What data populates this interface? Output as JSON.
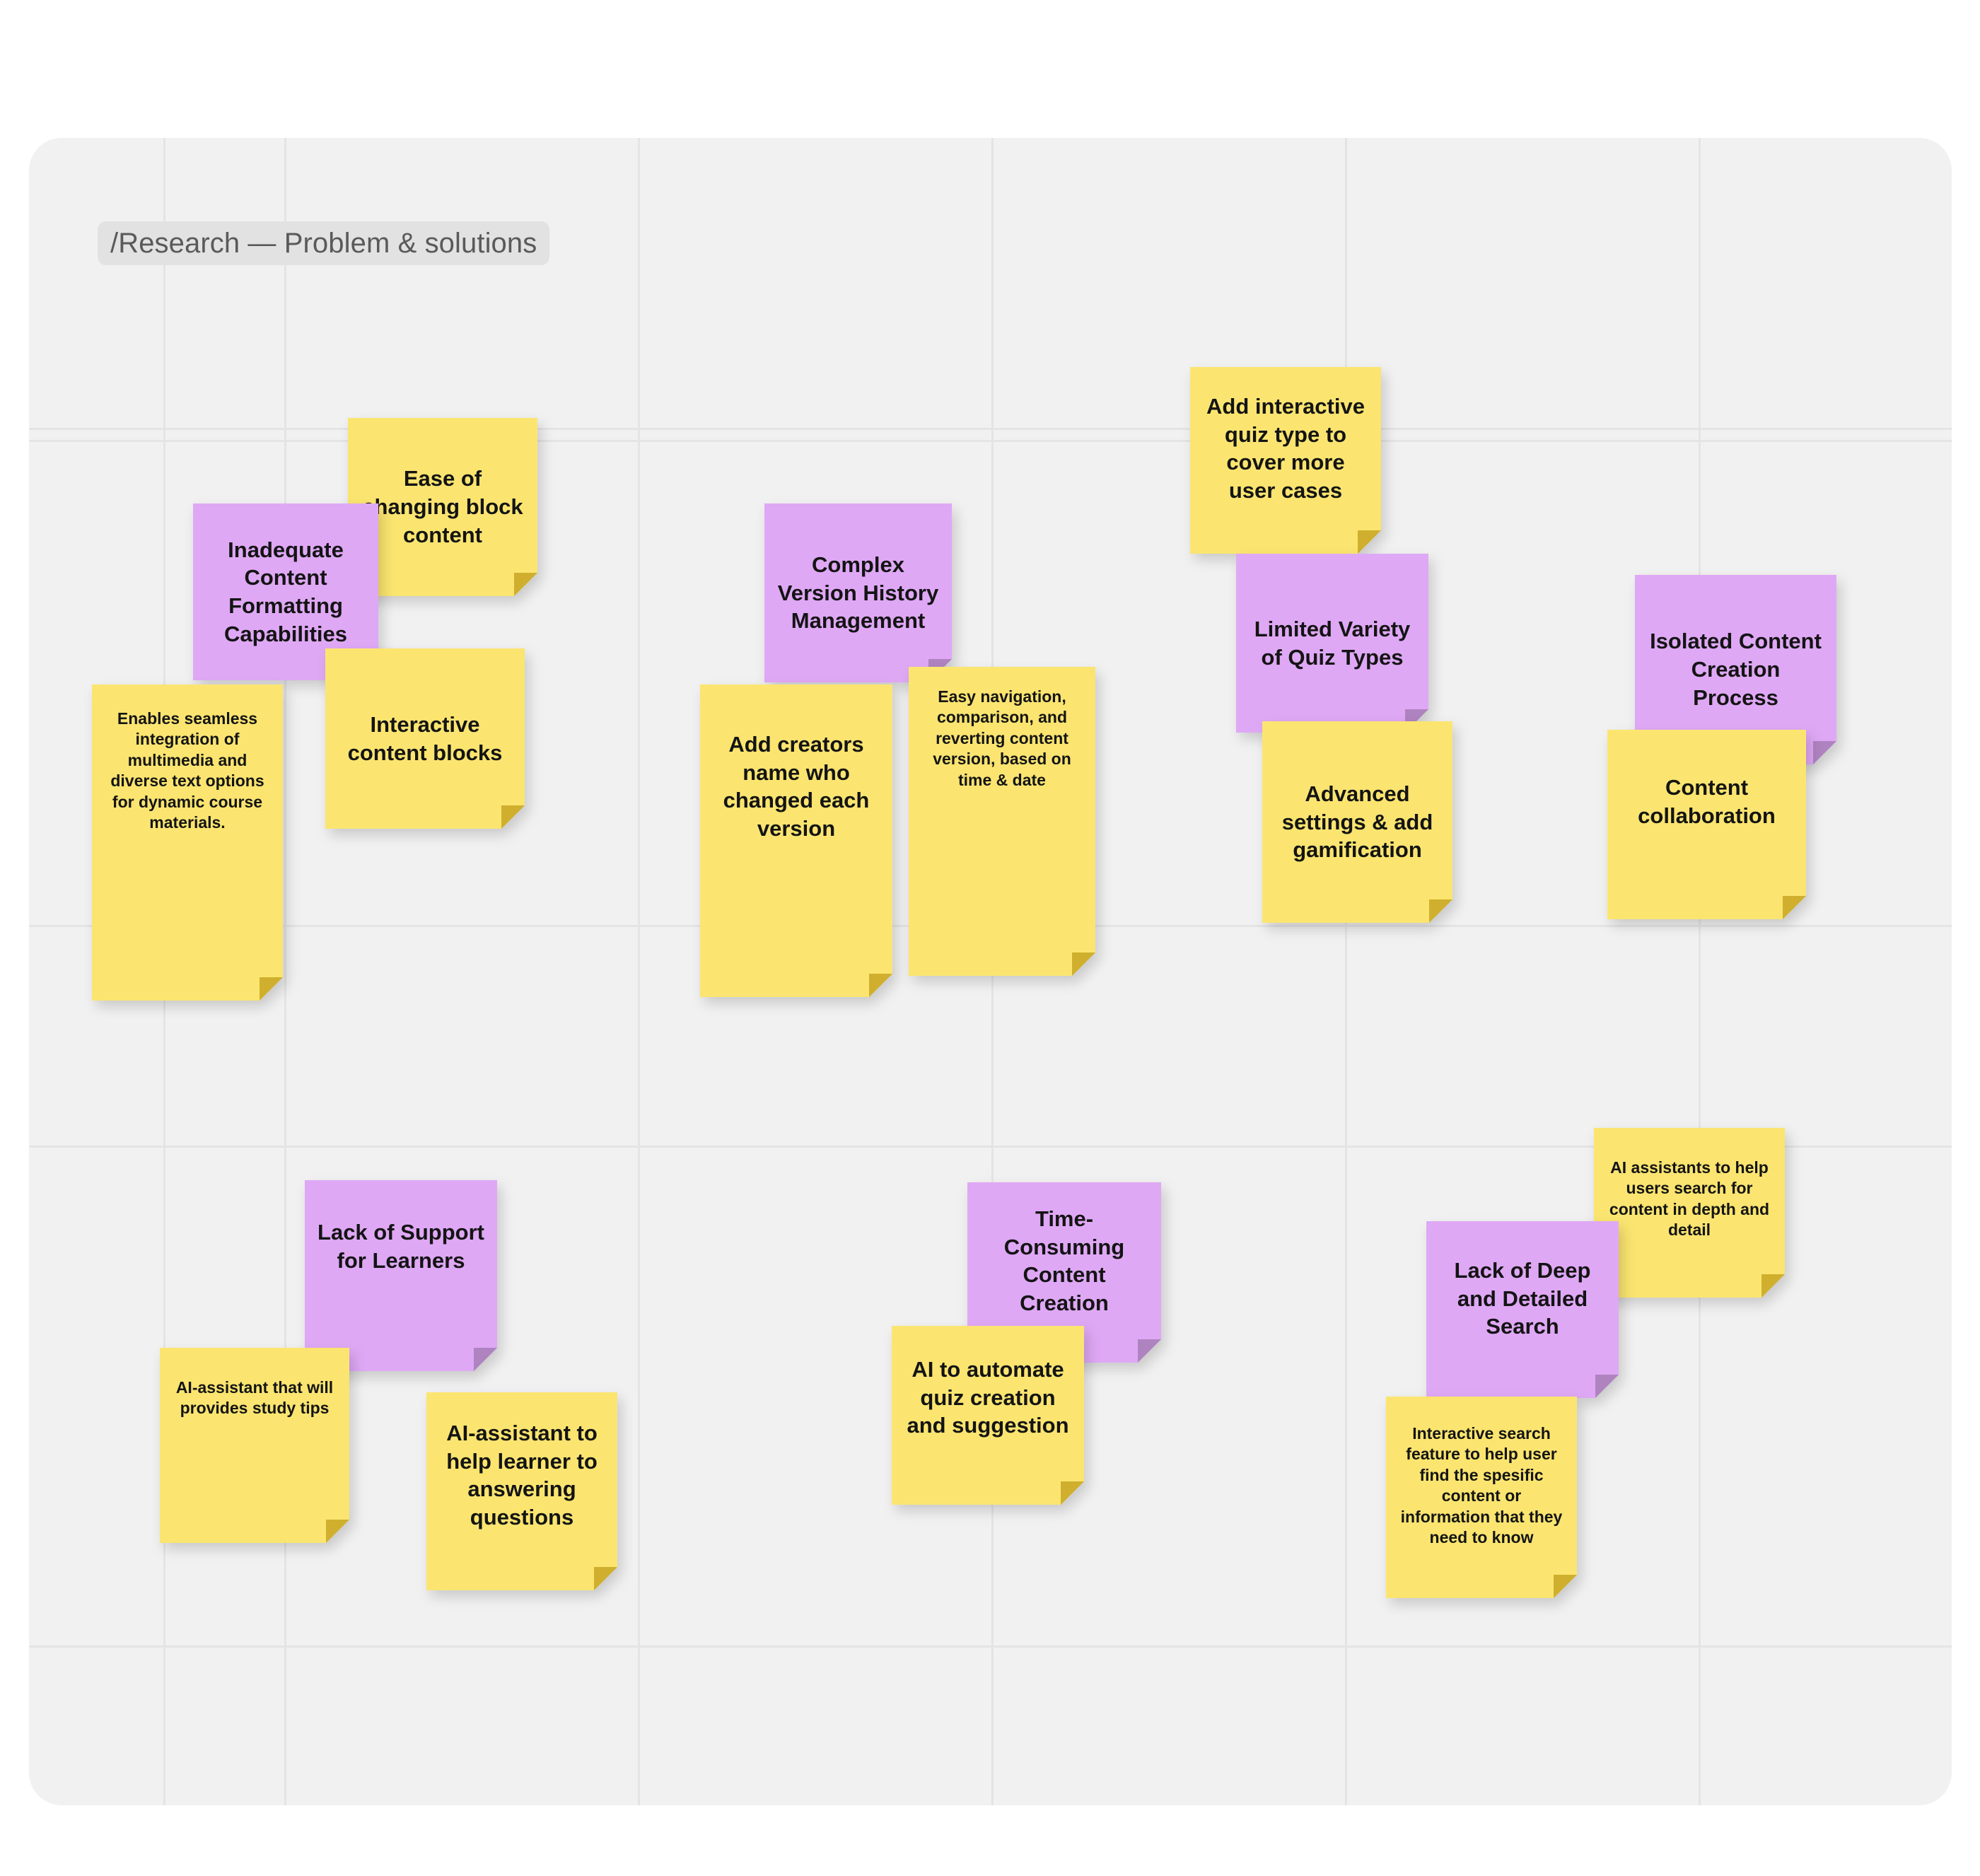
{
  "board": {
    "frame_label": "/Research — Problem & solutions",
    "background_color": "#f1f1f1",
    "page_background": "#ffffff",
    "grid_line_color": "#e4e4e4",
    "chip_background": "#e2e2e2",
    "chip_text_color": "#5a5a5a"
  },
  "palette": {
    "problem_note": "#dfa8f5",
    "problem_fold": "#af83c0",
    "solution_note": "#fbe570",
    "solution_fold": "#cfaf2d",
    "note_text": "#141414"
  },
  "clusters": [
    {
      "id": "content-formatting",
      "problem": "Inadequate Content Formatting Capabilities",
      "solutions": [
        "Ease of changing block content",
        "Interactive content blocks",
        "Enables seamless integration of multimedia and diverse text options for dynamic course materials."
      ]
    },
    {
      "id": "version-history",
      "problem": "Complex Version History Management",
      "solutions": [
        "Add creators name who changed each version",
        "Easy navigation, comparison, and reverting content version, based on time & date"
      ]
    },
    {
      "id": "quiz-variety",
      "problem": "Limited Variety of Quiz Types",
      "solutions": [
        "Add interactive quiz type to cover more user cases",
        "Advanced settings & add gamification"
      ]
    },
    {
      "id": "isolated-creation",
      "problem": "Isolated Content Creation Process",
      "solutions": [
        "Content collaboration"
      ]
    },
    {
      "id": "learner-support",
      "problem": "Lack of Support for Learners",
      "solutions": [
        "AI-assistant that will provides study tips",
        "AI-assistant to help learner to answering questions"
      ]
    },
    {
      "id": "time-consuming",
      "problem": "Time-Consuming Content Creation",
      "solutions": [
        "AI to automate quiz creation and suggestion"
      ]
    },
    {
      "id": "deep-search",
      "problem": "Lack of Deep and Detailed Search",
      "solutions": [
        "AI assistants to help users search for content in depth and detail",
        "Interactive search feature to help user find the spesific content or information that they need to know"
      ]
    }
  ],
  "notes": {
    "ease_of_changing_block_content": "Ease of changing block content",
    "inadequate_content_formatting": "Inadequate Content Formatting Capabilities",
    "interactive_content_blocks": "Interactive content blocks",
    "enables_seamless_integration": "Enables seamless integration of multimedia and diverse text options for dynamic course materials.",
    "complex_version_history": "Complex Version History Management",
    "add_creators_name": "Add creators name who changed each version",
    "easy_navigation": "Easy navigation, comparison, and reverting content version, based on time & date",
    "add_interactive_quiz_type": "Add interactive quiz type to cover more user cases",
    "limited_variety_quiz": "Limited Variety of Quiz Types",
    "advanced_settings_gamification": "Advanced settings & add gamification",
    "isolated_content_creation": "Isolated Content Creation Process",
    "content_collaboration": "Content collaboration",
    "lack_of_support_learners": "Lack of Support for Learners",
    "ai_assistant_study_tips": "AI-assistant that will provides study tips",
    "ai_assistant_answering": "AI-assistant to help learner to answering questions",
    "time_consuming_content": "Time-Consuming Content Creation",
    "ai_automate_quiz": "AI to automate quiz creation and suggestion",
    "ai_assistants_search": "AI assistants to help users search for content in depth and detail",
    "lack_of_deep_search": "Lack of Deep and Detailed Search",
    "interactive_search_feature": "Interactive search feature to help user find the spesific content or information that they need to know"
  }
}
